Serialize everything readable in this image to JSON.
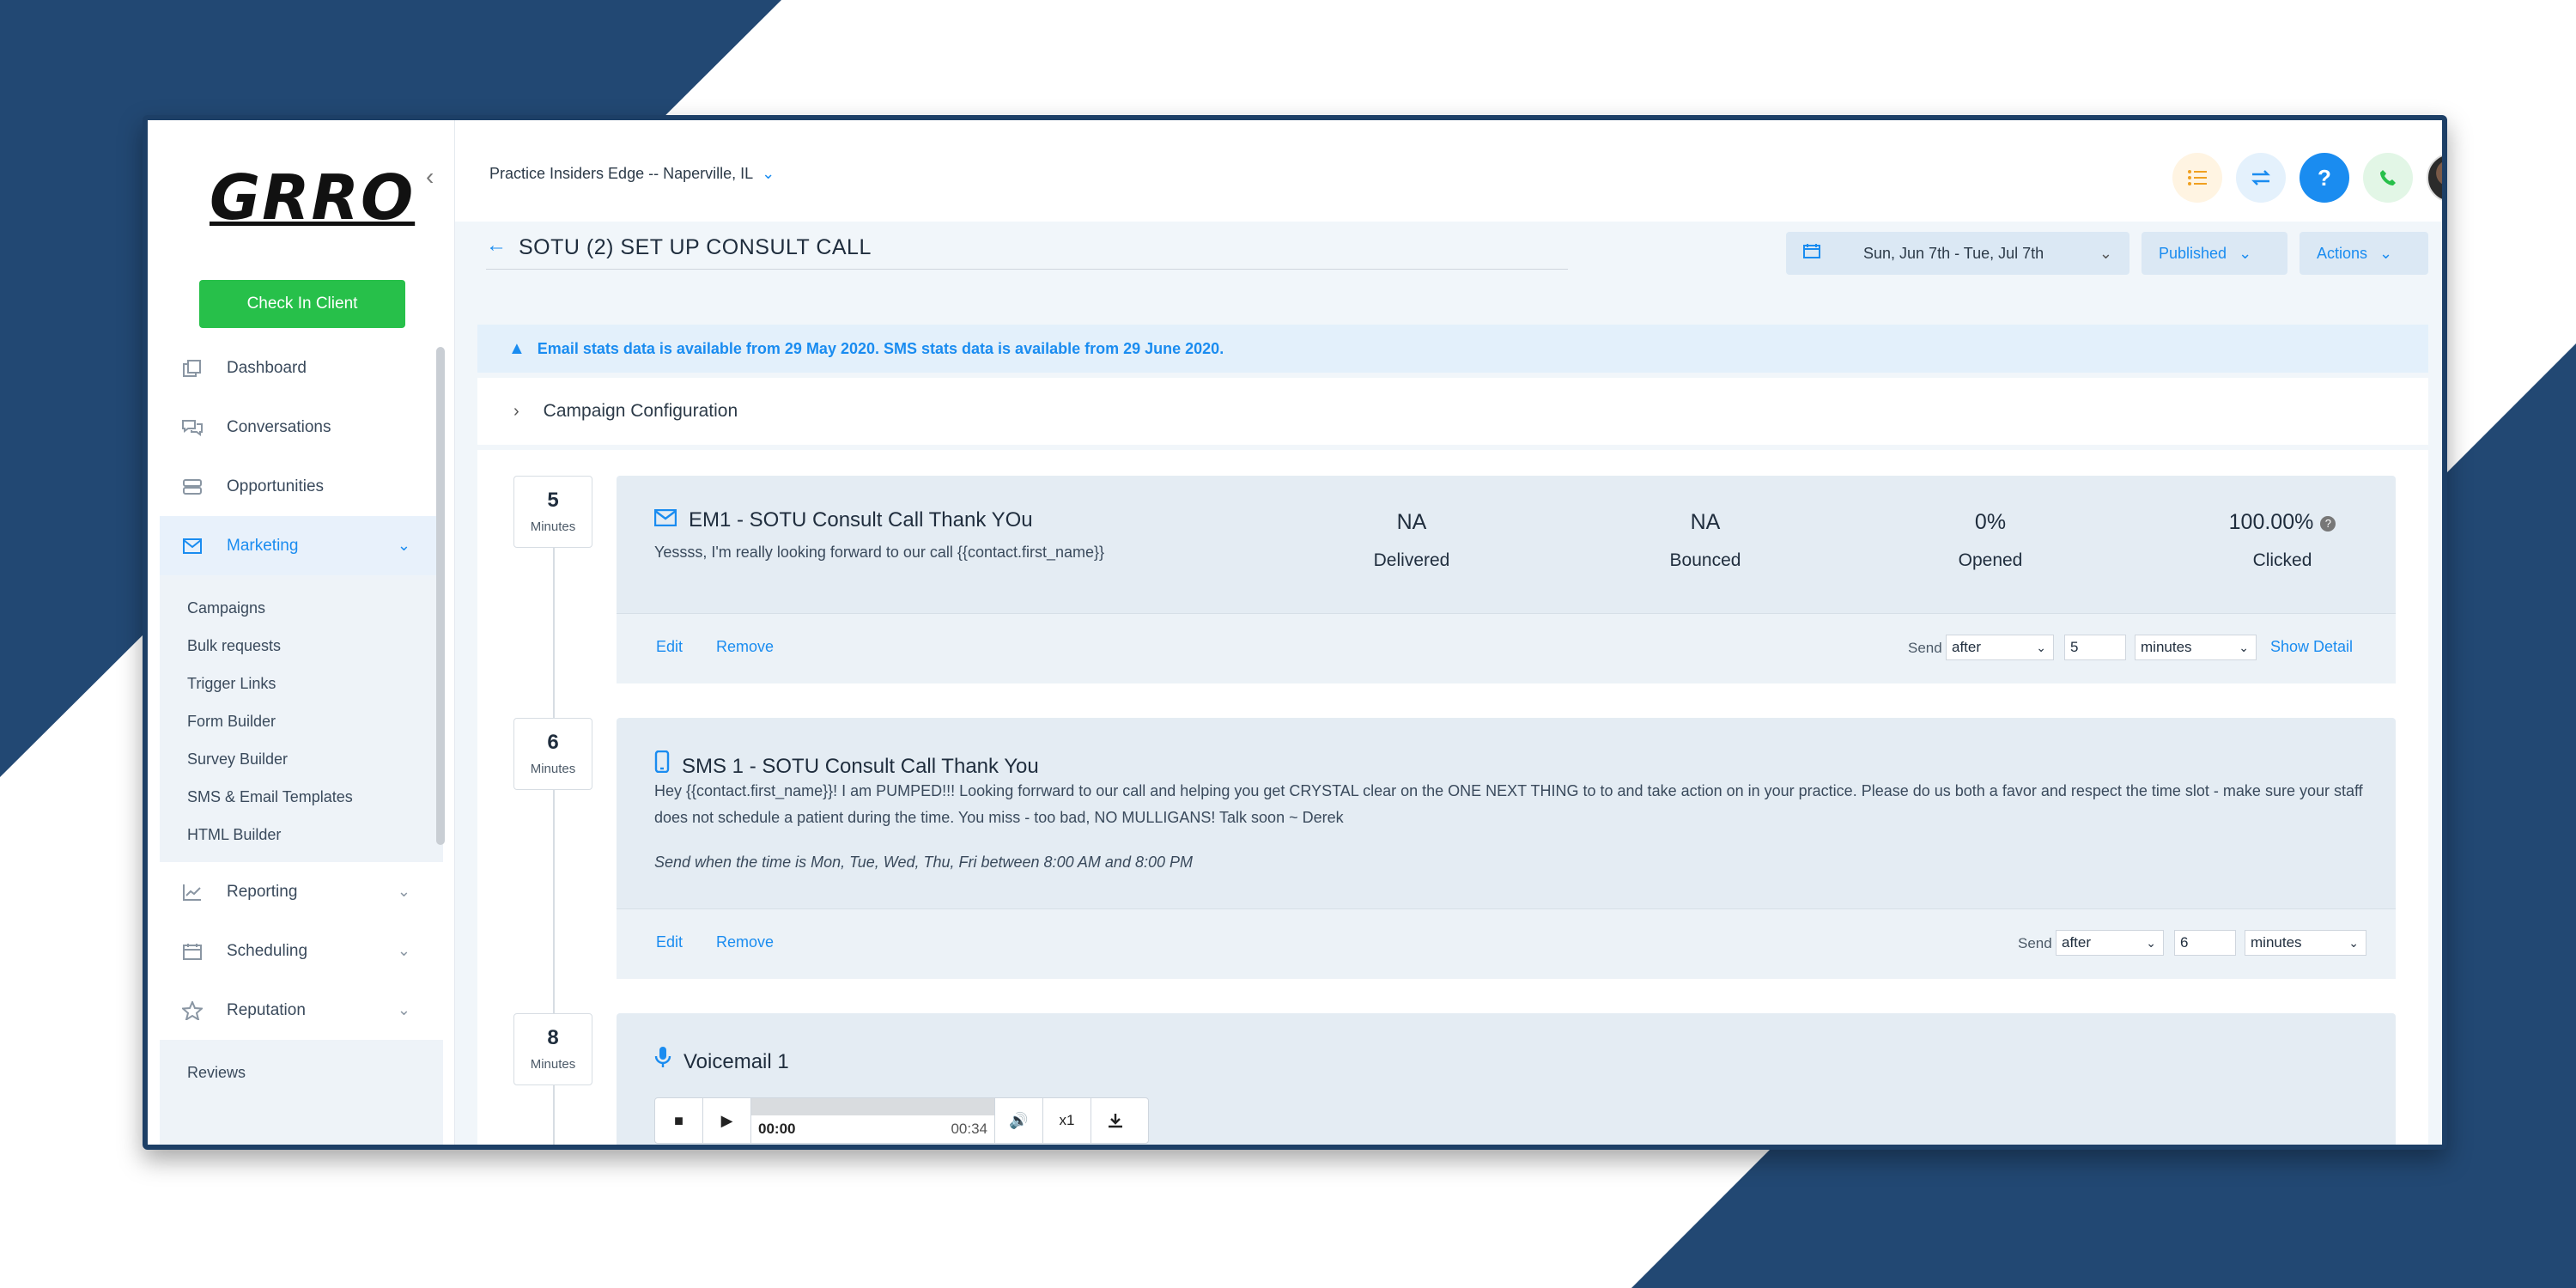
{
  "sidebar": {
    "logo": "GRRO",
    "checkin_label": "Check In Client",
    "nav": [
      {
        "label": "Dashboard"
      },
      {
        "label": "Conversations"
      },
      {
        "label": "Opportunities"
      },
      {
        "label": "Marketing"
      }
    ],
    "marketing_sub": [
      "Campaigns",
      "Bulk requests",
      "Trigger Links",
      "Form Builder",
      "Survey Builder",
      "SMS & Email Templates",
      "HTML Builder"
    ],
    "nav2": [
      {
        "label": "Reporting"
      },
      {
        "label": "Scheduling"
      },
      {
        "label": "Reputation"
      }
    ],
    "reputation_sub": [
      "Reviews"
    ]
  },
  "topbar": {
    "location": "Practice Insiders Edge -- Naperville, IL",
    "help_label": "?"
  },
  "header": {
    "title": "SOTU (2) SET UP CONSULT CALL",
    "date_range": "Sun, Jun 7th - Tue, Jul 7th",
    "status": "Published",
    "actions": "Actions"
  },
  "alert": "Email stats data is available from 29 May 2020. SMS stats data is available from 29 June 2020.",
  "config_label": "Campaign Configuration",
  "steps": [
    {
      "delay": "5",
      "unit": "Minutes",
      "title": "EM1 - SOTU Consult Call Thank YOu",
      "body": "Yessss, I'm really looking forward to our call {{contact.first_name}}",
      "stats": [
        {
          "value": "NA",
          "label": "Delivered"
        },
        {
          "value": "NA",
          "label": "Bounced"
        },
        {
          "value": "0%",
          "label": "Opened"
        },
        {
          "value": "100.00%",
          "label": "Clicked"
        }
      ],
      "edit": "Edit",
      "remove": "Remove",
      "send_label": "Send",
      "send_when": "after",
      "send_amount": "5",
      "send_unit": "minutes",
      "show_detail": "Show Detail"
    },
    {
      "delay": "6",
      "unit": "Minutes",
      "title": "SMS 1 - SOTU Consult Call Thank You",
      "body": "Hey {{contact.first_name}}!  I am PUMPED!!! Looking forrward to our call and helping you get CRYSTAL clear on the ONE NEXT THING to to and take action on in your practice. Please do us both a favor and respect the time slot - make sure your staff does not schedule a patient during the time.  You miss - too bad, NO MULLIGANS! Talk soon ~ Derek",
      "schedule": "Send when the time is Mon, Tue, Wed, Thu, Fri between 8:00 AM and 8:00 PM",
      "edit": "Edit",
      "remove": "Remove",
      "send_label": "Send",
      "send_when": "after",
      "send_amount": "6",
      "send_unit": "minutes"
    },
    {
      "delay": "8",
      "unit": "Minutes",
      "title": "Voicemail 1",
      "player": {
        "current": "00:00",
        "duration": "00:34",
        "speed": "x1"
      }
    }
  ],
  "colors": {
    "brand_blue": "#1a8cf0",
    "green": "#27c04a",
    "background_navy": "#224873"
  }
}
